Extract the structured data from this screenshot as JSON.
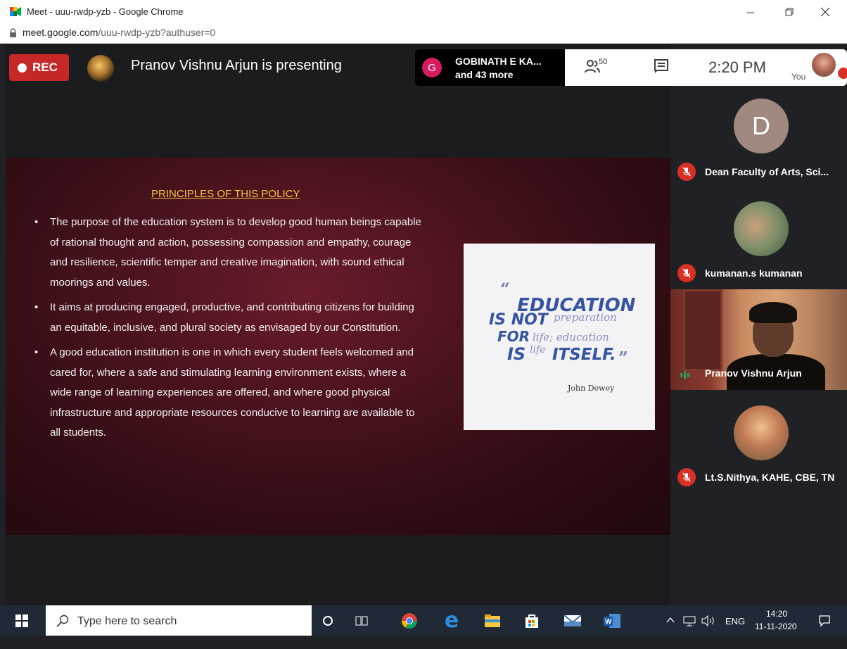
{
  "window": {
    "title": "Meet - uuu-rwdp-yzb - Google Chrome"
  },
  "address": {
    "host": "meet.google.com",
    "path": "/uuu-rwdp-yzb?authuser=0"
  },
  "meet": {
    "rec_label": "REC",
    "presenting_text": "Pranov Vishnu Arjun is presenting",
    "participants_preview": {
      "initial": "G",
      "name": "GOBINATH E KA...",
      "more": "and 43 more"
    },
    "people_count": "50",
    "clock": "2:20 PM",
    "you_label": "You"
  },
  "slide": {
    "title": "PRINCIPLES OF THIS POLICY",
    "bullets": [
      " The purpose of the education system is to develop good human beings capable of rational thought and action, possessing compassion and empathy, courage and resilience, scientific temper and creative imagination, with sound ethical moorings and values.",
      "It aims at producing engaged, productive, and contributing citizens for building an equitable, inclusive, and plural society as envisaged by our Constitution.",
      "A good education institution is one in which every student feels welcomed and cared for, where a safe and stimulating learning environment exists, where a wide range of learning experiences are offered, and where good physical infrastructure and appropriate resources conducive to learning are available to all students."
    ],
    "quote": {
      "open_mark": "“",
      "line1": "EDUCATION",
      "line2a": "IS NOT",
      "line2b": "preparation",
      "line3a": "FOR",
      "line3b": "life; education",
      "line4a": "IS",
      "line4b": "life",
      "line4c": "ITSELF.",
      "close_mark": "”",
      "author": "John Dewey"
    }
  },
  "participants": [
    {
      "initial": "D",
      "name": "Dean Faculty of Arts, Sci...",
      "avatar_color": "#a1887f",
      "muted": true
    },
    {
      "name": "kumanan.s kumanan",
      "muted": true
    },
    {
      "name": "Pranov Vishnu Arjun",
      "speaking": true
    },
    {
      "name": "Lt.S.Nithya, KAHE, CBE, TN",
      "muted": true
    }
  ],
  "taskbar": {
    "search_placeholder": "Type here to search",
    "lang": "ENG",
    "time": "14:20",
    "date": "11-11-2020"
  },
  "colors": {
    "rec_red": "#c62828",
    "mute_red": "#d93025",
    "slide_title": "#f4c542",
    "quote_blue": "#3654a0"
  }
}
